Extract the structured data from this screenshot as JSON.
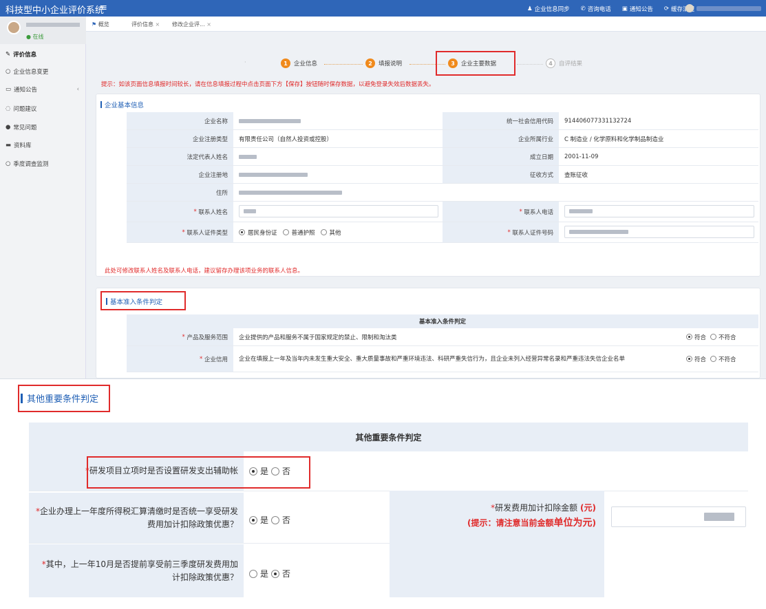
{
  "app": {
    "title": "科技型中小企业评价系统"
  },
  "top_actions": [
    {
      "icon": "user-sync-icon",
      "label": "企业信息同步"
    },
    {
      "icon": "phone-icon",
      "label": "咨询电话"
    },
    {
      "icon": "notice-icon",
      "label": "通知公告"
    },
    {
      "icon": "refresh-icon",
      "label": "缓存清理"
    }
  ],
  "sidebar": {
    "user_status": "● 在线",
    "items": [
      {
        "icon": "edit-icon",
        "label": "评价信息",
        "active": true
      },
      {
        "icon": "circle-icon",
        "label": "企业信息变更"
      },
      {
        "icon": "notice-icon",
        "label": "通知公告",
        "caret": "‹"
      },
      {
        "icon": "chat-icon",
        "label": "问题建议"
      },
      {
        "icon": "question-icon",
        "label": "常见问题"
      },
      {
        "icon": "folder-icon",
        "label": "资料库"
      },
      {
        "icon": "circle-icon",
        "label": "季度调查监测"
      }
    ]
  },
  "tabs": [
    {
      "label": "概览",
      "icon": "home-icon"
    },
    {
      "label": "评价信息",
      "close": "×"
    },
    {
      "label": "修改企业评...",
      "close": "×"
    }
  ],
  "steps": [
    {
      "num": "1",
      "label": "企业信息"
    },
    {
      "num": "2",
      "label": "填报说明"
    },
    {
      "num": "3",
      "label": "企业主要数据"
    },
    {
      "num": "4",
      "label": "自评结果"
    }
  ],
  "tip": "提示：如该页面信息填报时间较长，请在信息填报过程中点击页面下方【保存】按钮随时保存数据，以避免登录失效后数据丢失。",
  "basic_info": {
    "section_title": "企业基本信息",
    "name_label": "企业名称",
    "credit_code_label": "统一社会信用代码",
    "credit_code": "914406077331132724",
    "reg_type_label": "企业注册类型",
    "reg_type": "有限责任公司（自然人投资或控股）",
    "industry_label": "企业所属行业",
    "industry": "C 制造业 / 化学原料和化学制品制造业",
    "legal_rep_label": "法定代表人姓名",
    "founded_label": "成立日期",
    "founded": "2001-11-09",
    "reg_place_label": "企业注册地",
    "tax_method_label": "征收方式",
    "tax_method": "查账征收",
    "address_label": "住所",
    "contact_name_label": "联系人姓名",
    "contact_phone_label": "联系人电话",
    "id_type_label": "联系人证件类型",
    "id_type_options": [
      "居民身份证",
      "普通护照",
      "其他"
    ],
    "id_number_label": "联系人证件号码",
    "warn": "此处可修改联系人姓名及联系人电话，建议留存办理该项业务的联系人信息。"
  },
  "access": {
    "section_title": "基本准入条件判定",
    "table_header": "基本准入条件判定",
    "rows": [
      {
        "label": "产品及服务范围",
        "text": "企业提供的产品和服务不属于国家规定的禁止、限制和淘汰类",
        "yes": "符合",
        "no": "不符合"
      },
      {
        "label": "企业信用",
        "text": "企业在填报上一年及当年内未发生重大安全、重大质量事故和严重环境违法、科研严重失信行为，且企业未列入经营异常名录和严重违法失信企业名单",
        "yes": "符合",
        "no": "不符合"
      }
    ]
  },
  "other": {
    "section_title": "其他重要条件判定",
    "table_header": "其他重要条件判定",
    "q1": "研发项目立项时是否设置研发支出辅助帐",
    "q2": "企业办理上一年度所得税汇算清缴时是否统一享受研发费用加计扣除政策优惠？",
    "q3": "其中，上一年10月是否提前享受前三季度研发费用加计扣除政策优惠？",
    "amount_label": "研发费用加计扣除金额",
    "amount_unit": "(元)",
    "amount_hint_prefix": "(提示：请注意当前金额",
    "amount_hint_emph": "单位为元",
    "amount_hint_suffix": ")",
    "yes": "是",
    "no": "否"
  },
  "colors": {
    "primary": "#2f66b8",
    "accent": "#f08a1c",
    "warning": "#e02a2a",
    "label_bg": "#e8eef6"
  }
}
